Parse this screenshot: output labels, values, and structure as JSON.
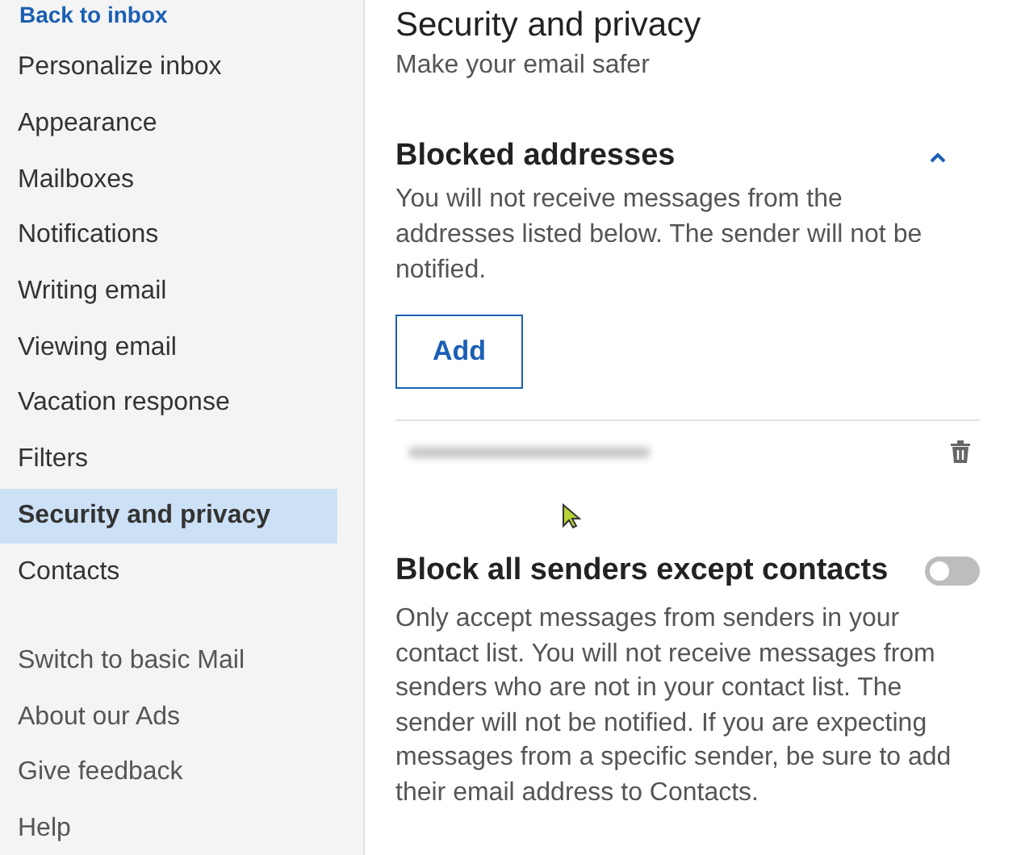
{
  "sidebar": {
    "back_link": "Back to inbox",
    "items": [
      {
        "label": "Personalize inbox",
        "selected": false
      },
      {
        "label": "Appearance",
        "selected": false
      },
      {
        "label": "Mailboxes",
        "selected": false
      },
      {
        "label": "Notifications",
        "selected": false
      },
      {
        "label": "Writing email",
        "selected": false
      },
      {
        "label": "Viewing email",
        "selected": false
      },
      {
        "label": "Vacation response",
        "selected": false
      },
      {
        "label": "Filters",
        "selected": false
      },
      {
        "label": "Security and privacy",
        "selected": true
      },
      {
        "label": "Contacts",
        "selected": false
      }
    ],
    "footer_links": [
      "Switch to basic Mail",
      "About our Ads",
      "Give feedback",
      "Help"
    ]
  },
  "main": {
    "title": "Security and privacy",
    "subtitle": "Make your email safer",
    "blocked": {
      "heading": "Blocked addresses",
      "expanded": true,
      "description": "You will not receive messages from the addresses listed below. The sender will not be notified.",
      "add_button": "Add"
    },
    "block_all": {
      "heading": "Block all senders except contacts",
      "on": false,
      "description": "Only accept messages from senders in your contact list. You will not receive messages from senders who are not in your contact list. The sender will not be notified. If you are expecting messages from a specific sender, be sure to add their email address to Contacts."
    }
  }
}
